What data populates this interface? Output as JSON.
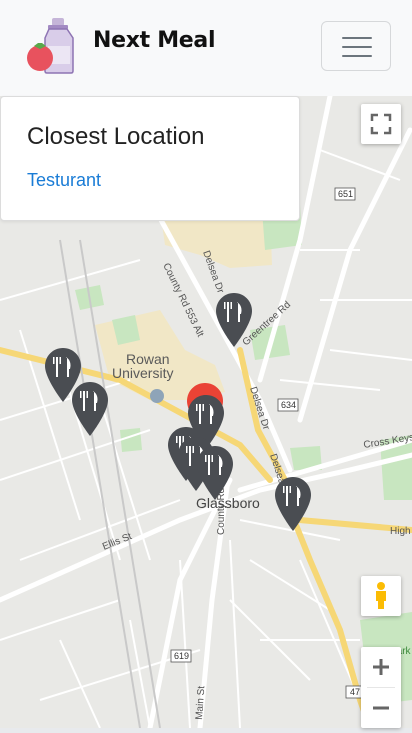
{
  "navbar": {
    "brand": "Next Meal",
    "logo_icon": "fruit-and-milk-bottle-logo",
    "menu_icon": "hamburger-menu-icon"
  },
  "card": {
    "title": "Closest Location",
    "link": "Testurant"
  },
  "map": {
    "labels": {
      "rowan": "Rowan",
      "university": "University",
      "glassboro": "Glassboro",
      "county_553": "County Rd 553 Alt",
      "county_553b": "County Rd 553 Alt",
      "delsea_dr": "Delsea Dr",
      "delsea_dr2": "Delsea Dr",
      "delsea_dr3": "Delsea",
      "greentree": "Greentree Rd",
      "ellis": "Ellis St",
      "main": "Main St",
      "cross_keys": "Cross Keys",
      "high": "High",
      "park": "Park",
      "shield_651": "651",
      "shield_634": "634",
      "shield_619": "619",
      "shield_47": "47"
    },
    "pin_icon": "restaurant-fork-knife-pin-icon",
    "colors": {
      "pin": "#4a4d52",
      "user_pin": "#ea4335",
      "road": "#ffffff",
      "highway": "#f6d776",
      "park": "#c8e6c0",
      "campus": "#f1e7c6"
    }
  },
  "controls": {
    "fullscreen_icon": "fullscreen-icon",
    "pegman_icon": "street-view-pegman-icon",
    "zoom_in": "+",
    "zoom_out": "−"
  }
}
